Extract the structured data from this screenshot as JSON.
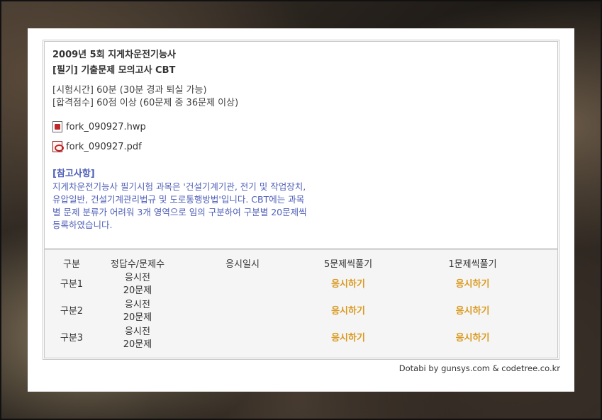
{
  "exam": {
    "title_line1": "2009년 5회 지게차운전기능사",
    "title_line2": "[필기] 기출문제 모의고사 CBT",
    "time": "[시험시간] 60분 (30분 경과 퇴실 가능)",
    "pass": "[합격점수] 60점 이상 (60문제 중 36문제 이상)"
  },
  "files": [
    {
      "name": "fork_090927.hwp",
      "icon": "hwp-file-icon"
    },
    {
      "name": "fork_090927.pdf",
      "icon": "pdf-file-icon"
    }
  ],
  "note": {
    "title": "[참고사항]",
    "body": "지게차운전기능사 필기시험 과목은 '건설기계기관, 전기 및 작업장치, 유압일반, 건설기계관리법규 및 도로통행방법'입니다. CBT에는 과목별 문제 분류가 어려워 3개 영역으로 임의 구분하여 구분별 20문제씩 등록하였습니다."
  },
  "table": {
    "headers": [
      "구분",
      "정답수/문제수",
      "응시일시",
      "5문제씩풀기",
      "1문제씩풀기"
    ],
    "rows": [
      {
        "name": "구분1",
        "status": "응시전",
        "count": "20문제",
        "date": "",
        "five": "응시하기",
        "one": "응시하기"
      },
      {
        "name": "구분2",
        "status": "응시전",
        "count": "20문제",
        "date": "",
        "five": "응시하기",
        "one": "응시하기"
      },
      {
        "name": "구분3",
        "status": "응시전",
        "count": "20문제",
        "date": "",
        "five": "응시하기",
        "one": "응시하기"
      }
    ]
  },
  "footer": "Dotabi by gunsys.com & codetree.co.kr",
  "colors": {
    "note": "#5060b8",
    "action": "#d99a1e"
  }
}
